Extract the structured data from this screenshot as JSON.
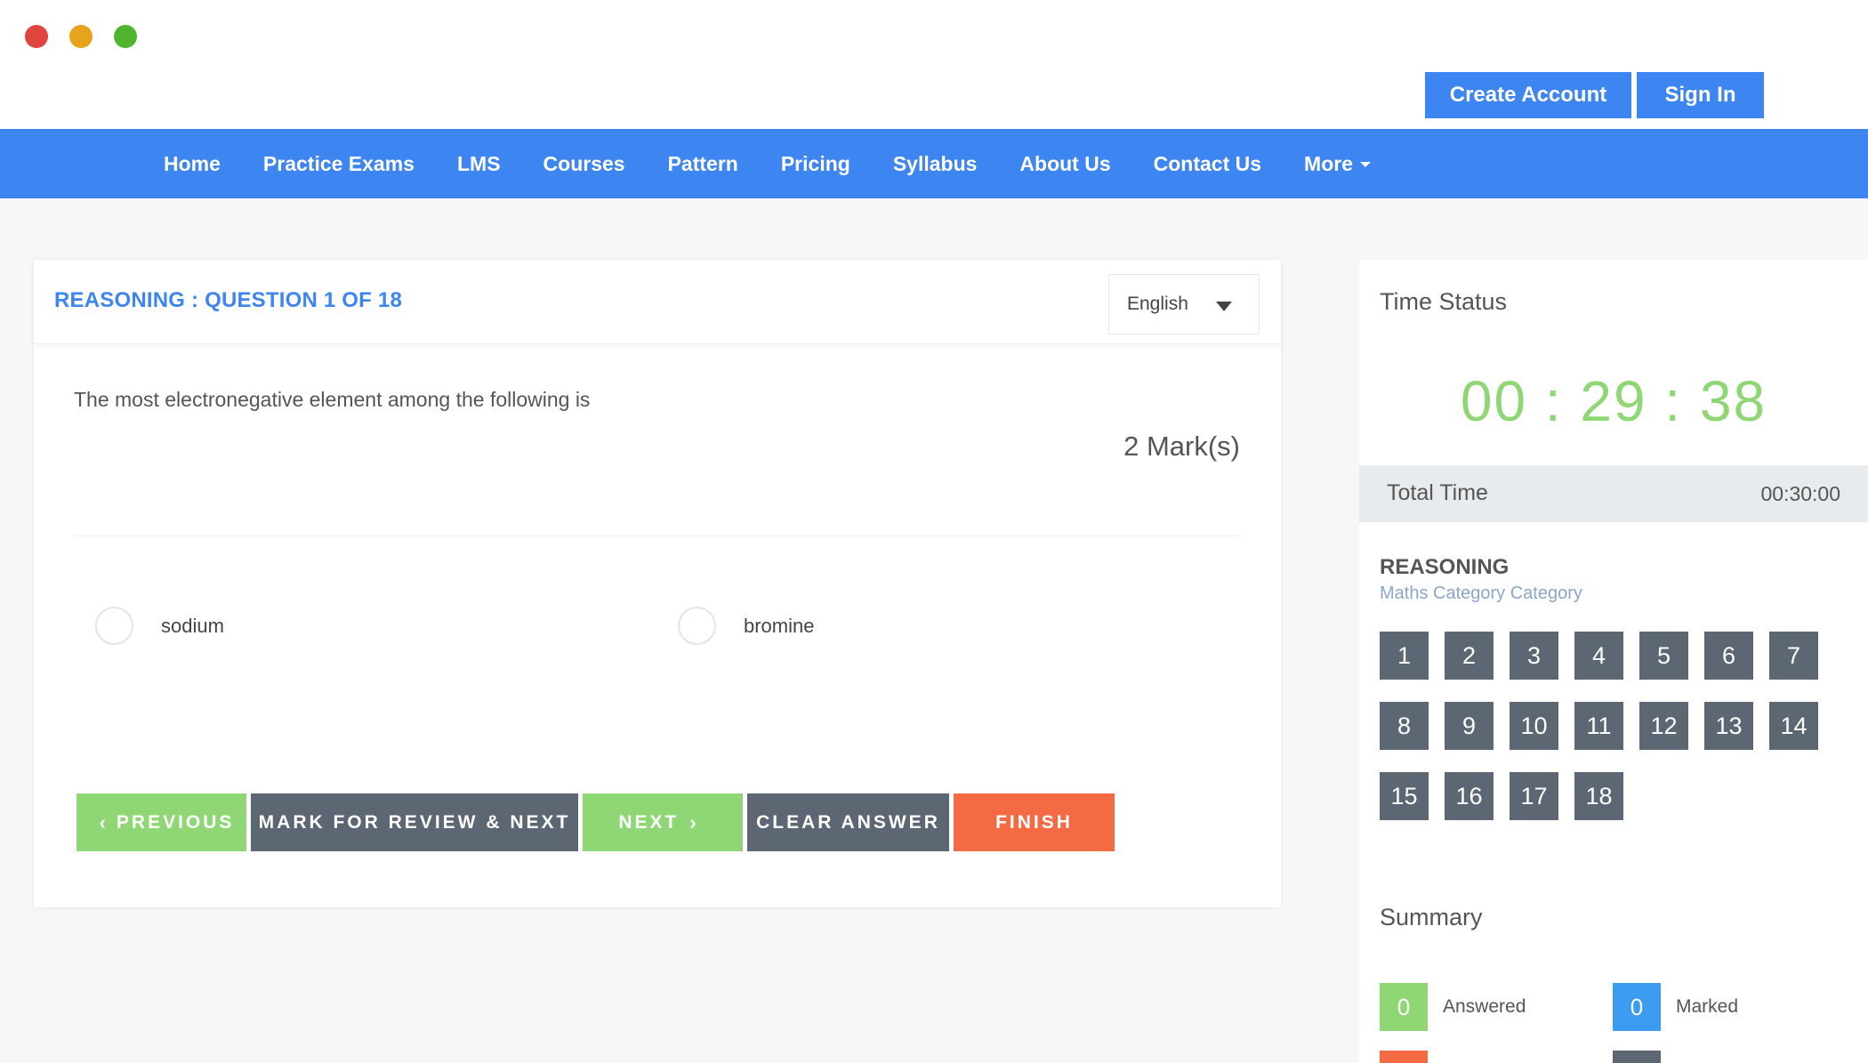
{
  "header": {
    "create_account": "Create Account",
    "sign_in": "Sign In"
  },
  "nav": {
    "items": [
      "Home",
      "Practice Exams",
      "LMS",
      "Courses",
      "Pattern",
      "Pricing",
      "Syllabus",
      "About Us",
      "Contact Us",
      "More"
    ]
  },
  "question": {
    "title": "REASONING : QUESTION 1 OF 18",
    "language": "English",
    "text": "The most electronegative element among the following is",
    "marks": "2 Mark(s)",
    "options": [
      "sodium",
      "bromine"
    ]
  },
  "actions": {
    "previous": "PREVIOUS",
    "mark_review": "MARK FOR REVIEW & NEXT",
    "next": "NEXT",
    "clear": "CLEAR ANSWER",
    "finish": "FINISH",
    "prev_chevron": "‹",
    "next_chevron": "›"
  },
  "time_status": {
    "title": "Time Status",
    "remaining": "00 : 29 : 38",
    "total_label": "Total Time",
    "total_value": "00:30:00"
  },
  "section": {
    "title": "REASONING",
    "subtitle": "Maths Category Category",
    "questions": [
      "1",
      "2",
      "3",
      "4",
      "5",
      "6",
      "7",
      "8",
      "9",
      "10",
      "11",
      "12",
      "13",
      "14",
      "15",
      "16",
      "17",
      "18"
    ]
  },
  "summary": {
    "title": "Summary",
    "answered_count": "0",
    "answered_label": "Answered",
    "marked_count": "0",
    "marked_label": "Marked"
  },
  "colors": {
    "primary": "#3d85f0",
    "green": "#8fd774",
    "dark": "#5d6673",
    "orange": "#f36a43"
  }
}
